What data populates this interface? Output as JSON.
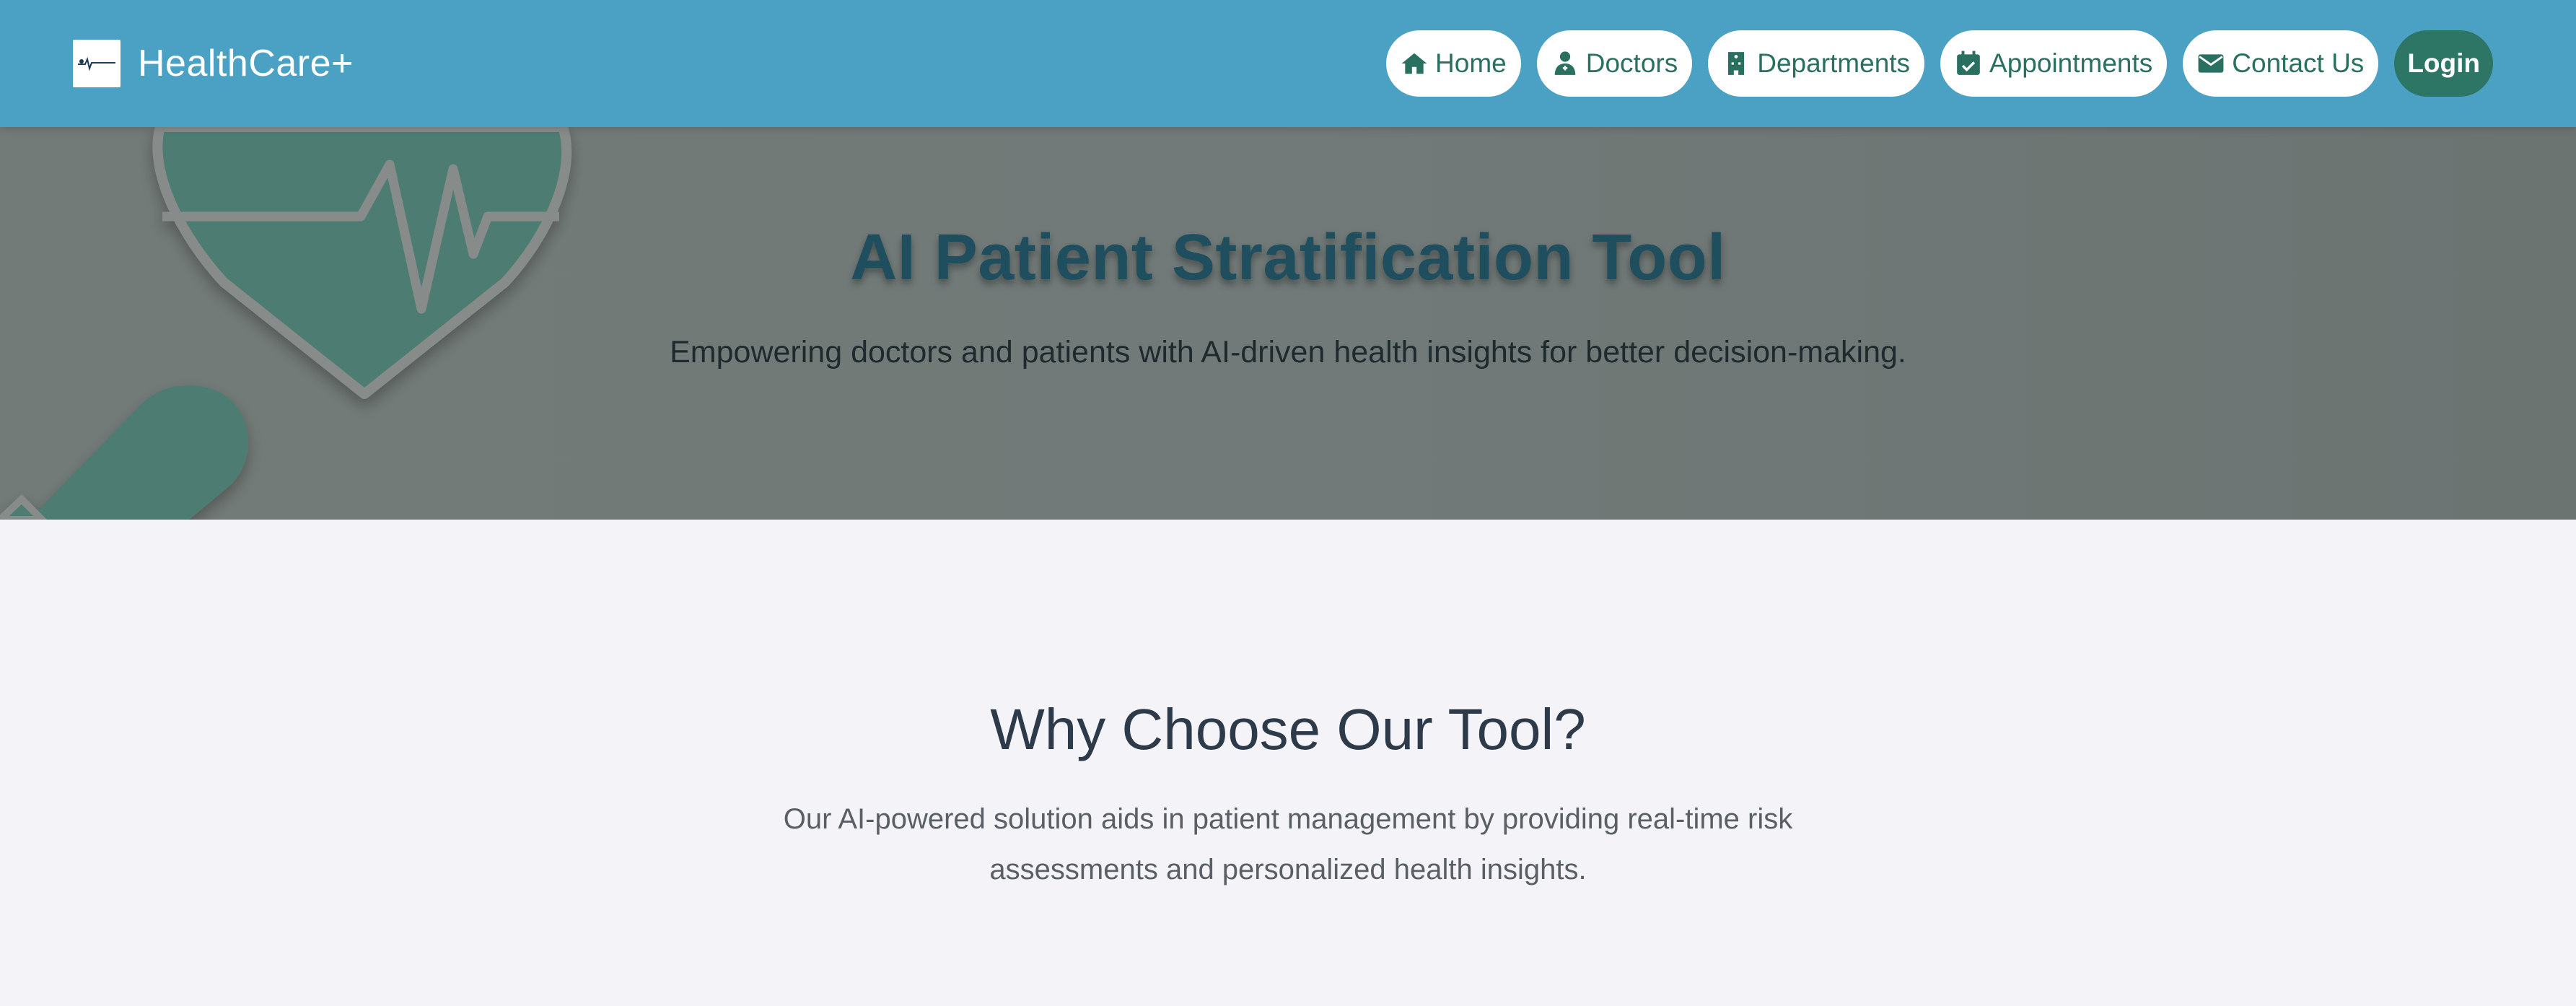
{
  "navbar": {
    "brand_name": "HealthCare+",
    "items": [
      {
        "label": "Home",
        "icon": "home-icon"
      },
      {
        "label": "Doctors",
        "icon": "doctor-icon"
      },
      {
        "label": "Departments",
        "icon": "hospital-icon"
      },
      {
        "label": "Appointments",
        "icon": "calendar-check-icon"
      },
      {
        "label": "Contact Us",
        "icon": "envelope-icon"
      }
    ],
    "login_label": "Login"
  },
  "hero": {
    "title": "AI Patient Stratification Tool",
    "subtitle": "Empowering doctors and patients with AI-driven health insights for better decision-making."
  },
  "why": {
    "title": "Why Choose Our Tool?",
    "text": "Our AI-powered solution aids in patient management by providing real-time risk assessments and personalized health insights."
  },
  "colors": {
    "navbar_bg": "#4aa1c3",
    "accent_green": "#2d7565",
    "hero_title": "#1f4f5e",
    "page_bg": "#f4f4f8"
  }
}
